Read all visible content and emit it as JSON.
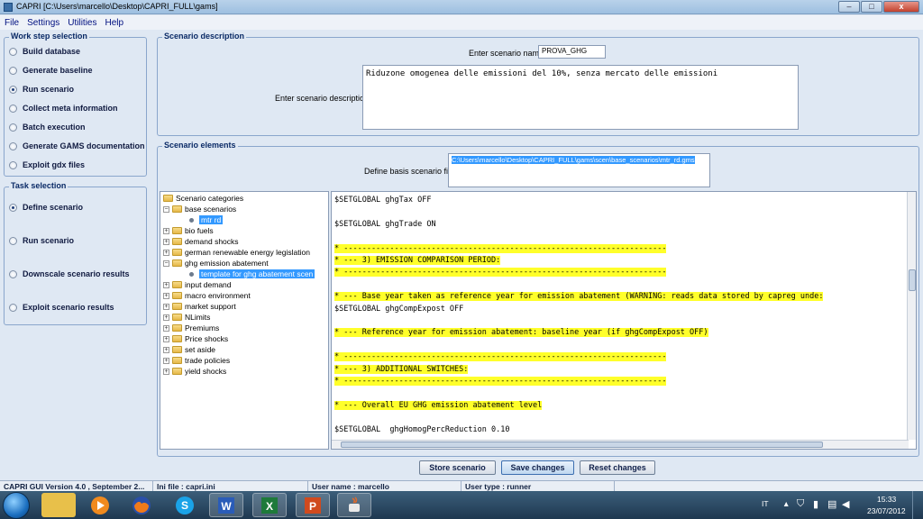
{
  "window": {
    "title": "CAPRI [C:\\Users\\marcello\\Desktop\\CAPRI_FULL\\gams]",
    "buttons": [
      "–",
      "□",
      "x"
    ]
  },
  "menu": [
    "File",
    "Settings",
    "Utilities",
    "Help"
  ],
  "work_step": {
    "title": "Work step selection",
    "items": [
      {
        "label": "Build database",
        "selected": false
      },
      {
        "label": "Generate baseline",
        "selected": false
      },
      {
        "label": "Run scenario",
        "selected": true
      },
      {
        "label": "Collect meta information",
        "selected": false
      },
      {
        "label": "Batch execution",
        "selected": false
      },
      {
        "label": "Generate GAMS documentation",
        "selected": false
      },
      {
        "label": "Exploit gdx files",
        "selected": false
      }
    ]
  },
  "task": {
    "title": "Task selection",
    "items": [
      {
        "label": "Define scenario",
        "selected": true
      },
      {
        "label": "Run scenario",
        "selected": false
      },
      {
        "label": "Downscale scenario results",
        "selected": false
      },
      {
        "label": "Exploit scenario results",
        "selected": false
      }
    ]
  },
  "scenario_description": {
    "title": "Scenario description",
    "name_label": "Enter scenario name",
    "name_value": "PROVA_GHG",
    "desc_label": "Enter scenario description",
    "desc_value": "Riduzone omogenea delle emissioni del 10%, senza mercato delle emissioni"
  },
  "scenario_elements": {
    "title": "Scenario elements",
    "basis_label": "Define basis scenario file",
    "basis_value": "C:\\Users\\marcello\\Desktop\\CAPRI_FULL\\gams\\scen\\base_scenarios\\mtr_rd.gms"
  },
  "tree": {
    "root": "Scenario categories",
    "items": [
      {
        "label": "base scenarios",
        "expanded": true
      },
      {
        "label": "mtr rd",
        "leaf": true,
        "selected": true
      },
      {
        "label": "bio fuels"
      },
      {
        "label": "demand shocks"
      },
      {
        "label": "german renewable energy legislation"
      },
      {
        "label": "ghg emission abatement",
        "expanded": true
      },
      {
        "label": "template for ghg abatement scen",
        "leaf": true,
        "selected": true
      },
      {
        "label": "input demand"
      },
      {
        "label": "macro environment"
      },
      {
        "label": "market support"
      },
      {
        "label": "NLimits"
      },
      {
        "label": "Premiums"
      },
      {
        "label": "Price shocks"
      },
      {
        "label": "set aside"
      },
      {
        "label": "trade policies"
      },
      {
        "label": "yield shocks"
      }
    ]
  },
  "code": [
    {
      "text": "$SETGLOBAL ghgTax OFF",
      "hl": false
    },
    {
      "text": "",
      "hl": false
    },
    {
      "text": "$SETGLOBAL ghgTrade ON",
      "hl": false
    },
    {
      "text": "",
      "hl": false
    },
    {
      "text": "* ----------------------------------------------------------------------",
      "hl": true
    },
    {
      "text": "* --- 3) EMISSION COMPARISON PERIOD:",
      "hl": true
    },
    {
      "text": "* ----------------------------------------------------------------------",
      "hl": true
    },
    {
      "text": "",
      "hl": false
    },
    {
      "text": "* --- Base year taken as reference year for emission abatement (WARNING: reads data stored by capreg unde:",
      "hl": true
    },
    {
      "text": "$SETGLOBAL ghgCompExpost OFF",
      "hl": false
    },
    {
      "text": "",
      "hl": false
    },
    {
      "text": "* --- Reference year for emission abatement: baseline year (if ghgCompExpost OFF)",
      "hl": true
    },
    {
      "text": "",
      "hl": false
    },
    {
      "text": "* ----------------------------------------------------------------------",
      "hl": true
    },
    {
      "text": "* --- 3) ADDITIONAL SWITCHES:",
      "hl": true
    },
    {
      "text": "* ----------------------------------------------------------------------",
      "hl": true
    },
    {
      "text": "",
      "hl": false
    },
    {
      "text": "* --- Overall EU GHG emission abatement level",
      "hl": true
    },
    {
      "text": "",
      "hl": false
    },
    {
      "text": "$SETGLOBAL  ghgHomogPercReduction 0.10",
      "hl": false
    }
  ],
  "buttons": {
    "store": "Store scenario",
    "save": "Save changes",
    "reset": "Reset changes"
  },
  "status": {
    "version": "CAPRI GUI Version 4.0 , September 2...",
    "ini": "Ini file : capri.ini",
    "user": "User name : marcello",
    "type": "User type : runner"
  },
  "tray": {
    "lang": "IT",
    "time": "15:33",
    "date": "23/07/2012"
  },
  "taskbar_icons": [
    "explorer",
    "media-player",
    "firefox",
    "skype",
    "word",
    "excel",
    "powerpoint",
    "java"
  ],
  "colors": {
    "highlight": "#ffff2a",
    "selection": "#3399ff",
    "panel_title": "#0a2a66"
  }
}
